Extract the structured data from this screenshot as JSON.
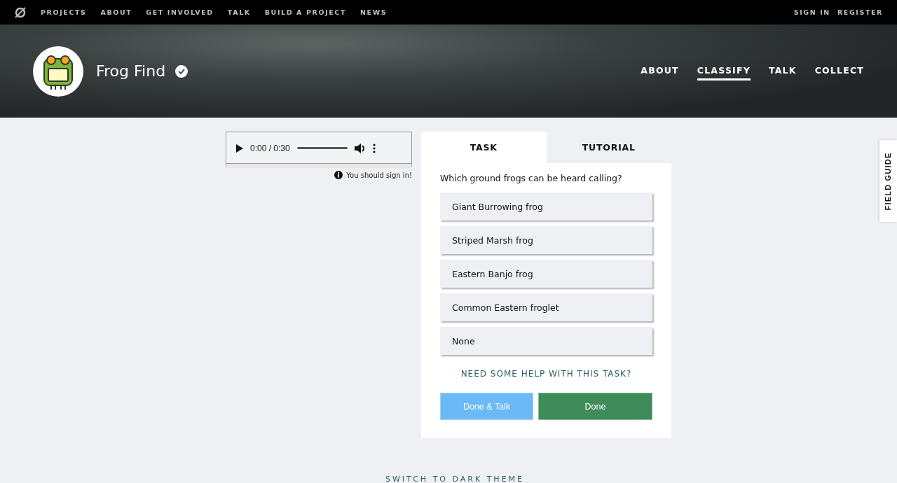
{
  "top_nav": {
    "links": [
      "PROJECTS",
      "ABOUT",
      "GET INVOLVED",
      "TALK",
      "BUILD A PROJECT",
      "NEWS"
    ],
    "account": [
      "SIGN IN",
      "REGISTER"
    ]
  },
  "project": {
    "title": "Frog Find",
    "verified": true,
    "nav": [
      {
        "label": "ABOUT",
        "selected": false
      },
      {
        "label": "CLASSIFY",
        "selected": true
      },
      {
        "label": "TALK",
        "selected": false
      },
      {
        "label": "COLLECT",
        "selected": false
      }
    ]
  },
  "player": {
    "time": "0:00 / 0:30",
    "notice": "You should sign in!"
  },
  "task_panel": {
    "tabs": [
      {
        "label": "TASK",
        "selected": true
      },
      {
        "label": "TUTORIAL",
        "selected": false
      }
    ],
    "question": "Which ground frogs can be heard calling?",
    "answers": [
      {
        "label": "Giant Burrowing frog",
        "selected": false
      },
      {
        "label": "Striped Marsh frog",
        "selected": false
      },
      {
        "label": "Eastern Banjo frog",
        "selected": false
      },
      {
        "label": "Common Eastern froglet",
        "selected": false
      },
      {
        "label": "None",
        "selected": false
      }
    ],
    "help_link": "NEED SOME HELP WITH THIS TASK?",
    "buttons": [
      {
        "label": "Done & Talk",
        "kind": "talk"
      },
      {
        "label": "Done",
        "kind": "done"
      }
    ]
  },
  "field_guide": "FIELD GUIDE",
  "theme_link": "SWITCH TO DARK THEME"
}
